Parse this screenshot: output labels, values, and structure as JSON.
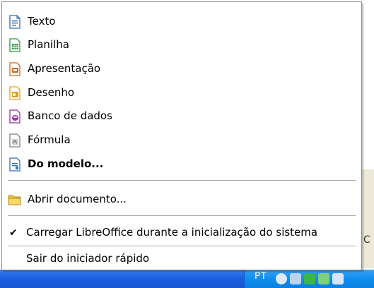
{
  "menu": {
    "new_items": [
      {
        "label": "Texto",
        "icon": "writer-document-icon",
        "color": "#2f6db5"
      },
      {
        "label": "Planilha",
        "icon": "calc-spreadsheet-icon",
        "color": "#2e9a3a"
      },
      {
        "label": "Apresentação",
        "icon": "impress-presentation-icon",
        "color": "#d2691e"
      },
      {
        "label": "Desenho",
        "icon": "draw-drawing-icon",
        "color": "#e0a020"
      },
      {
        "label": "Banco de dados",
        "icon": "base-database-icon",
        "color": "#9b2fa8"
      },
      {
        "label": "Fórmula",
        "icon": "math-formula-icon",
        "color": "#808080"
      },
      {
        "label": "Do modelo...",
        "icon": "template-icon",
        "color": "#2f6db5"
      }
    ],
    "open_document": {
      "label": "Abrir documento...",
      "icon": "folder-icon",
      "color": "#f0c040"
    },
    "preload": {
      "label": "Carregar LibreOffice durante a inicialização do sistema",
      "checked": true
    },
    "exit": {
      "label": "Sair do iniciador rápido"
    }
  },
  "taskbar": {
    "language": "PT",
    "background_char": "C"
  }
}
